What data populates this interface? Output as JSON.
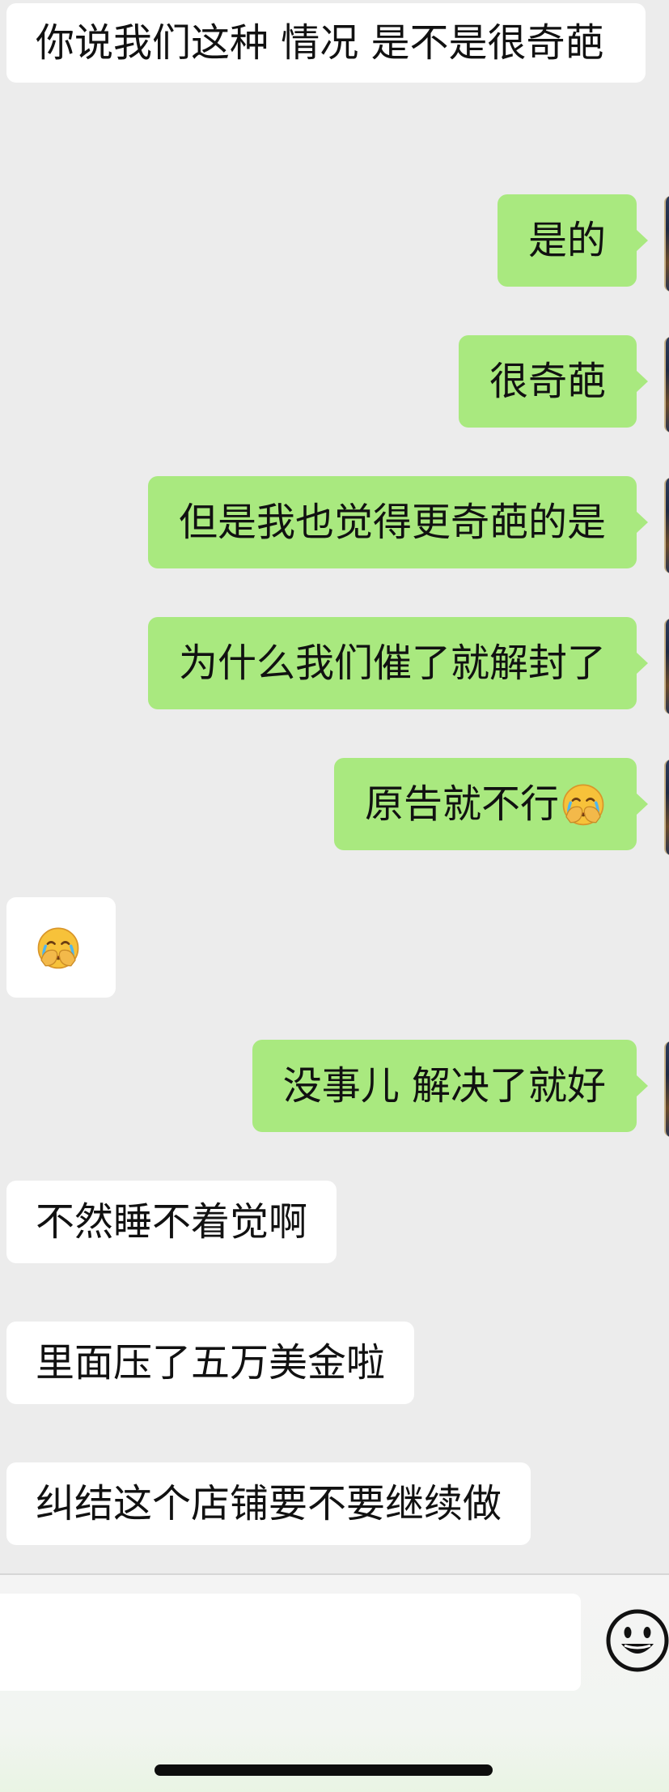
{
  "messages": [
    {
      "direction": "in",
      "text": "你说我们这种 情况  是不是很奇葩"
    },
    {
      "direction": "out",
      "text": "是的"
    },
    {
      "direction": "out",
      "text": "很奇葩"
    },
    {
      "direction": "out",
      "text": "但是我也觉得更奇葩的是"
    },
    {
      "direction": "out",
      "text": "为什么我们催了就解封了"
    },
    {
      "direction": "out",
      "text": "原告就不行",
      "emoji": "face-palm-crying-emoji"
    },
    {
      "direction": "in",
      "emoji": "face-palm-crying-emoji"
    },
    {
      "direction": "out",
      "text": "没事儿 解决了就好"
    },
    {
      "direction": "in",
      "text": "不然睡不着觉啊"
    },
    {
      "direction": "in",
      "text": "里面压了五万美金啦"
    },
    {
      "direction": "in",
      "text": "纠结这个店铺要不要继续做"
    }
  ],
  "input": {
    "value": "",
    "emoji_button_icon": "smiley-face-icon"
  },
  "colors": {
    "background": "#ececec",
    "outgoing_bubble": "#a9e97f",
    "incoming_bubble": "#ffffff"
  }
}
